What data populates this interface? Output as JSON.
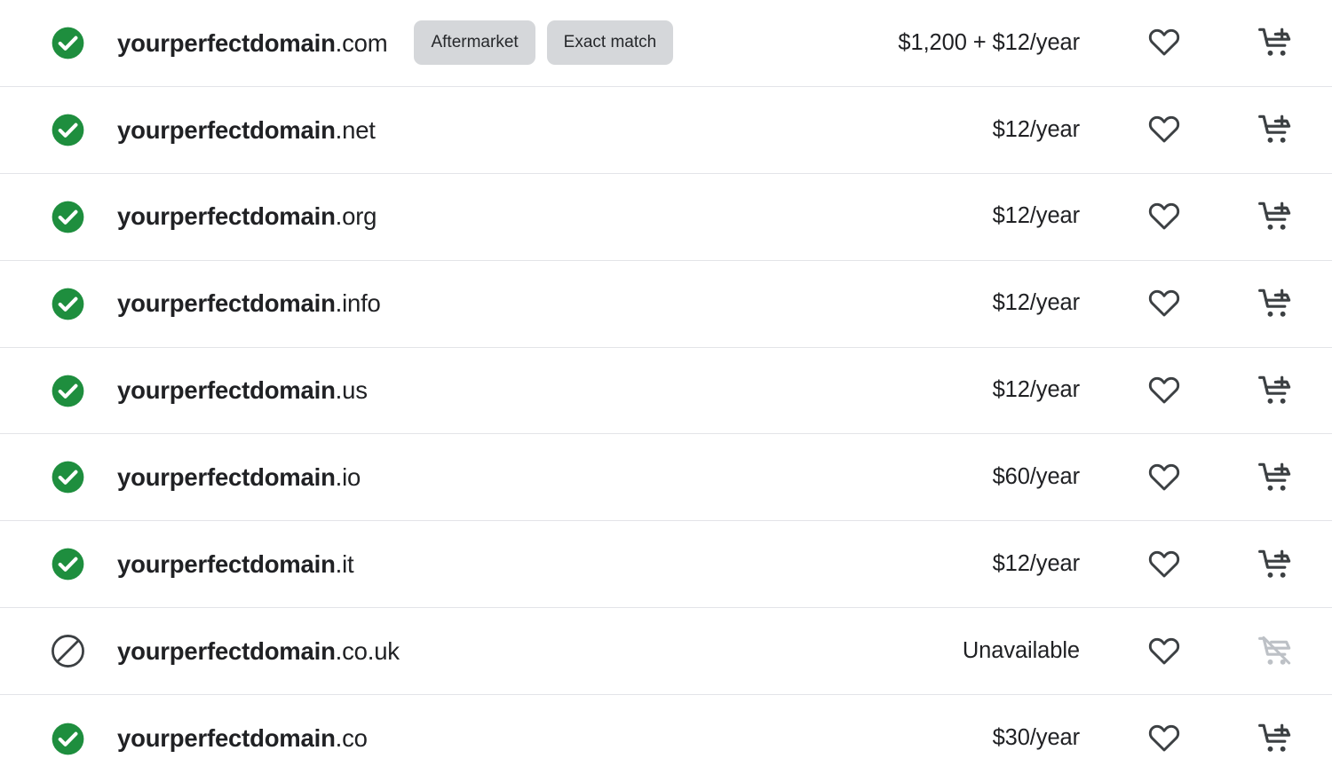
{
  "colors": {
    "available_green": "#1E8E3E",
    "icon_dark": "#3c4043",
    "icon_disabled": "#bdc1c6",
    "badge_bg": "#d5d7da",
    "text_primary": "#202124",
    "row_divider": "#e3e4e8",
    "page_bg": "#ffffff"
  },
  "icons": {
    "available": "check-circle-filled-icon",
    "unavailable": "slashed-circle-icon",
    "favorite": "heart-outline-icon",
    "add_to_cart": "cart-plus-icon",
    "cart_unavailable": "cart-slashed-icon"
  },
  "labels": {
    "unavailable_price": "Unavailable",
    "favorite_action": "Add to favorites",
    "cart_action": "Add to cart"
  },
  "results": [
    {
      "sld": "yourperfectdomain",
      "tld": ".com",
      "available": true,
      "price": "$1,200 + $12/year",
      "badges": [
        "Aftermarket",
        "Exact match"
      ]
    },
    {
      "sld": "yourperfectdomain",
      "tld": ".net",
      "available": true,
      "price": "$12/year",
      "badges": []
    },
    {
      "sld": "yourperfectdomain",
      "tld": ".org",
      "available": true,
      "price": "$12/year",
      "badges": []
    },
    {
      "sld": "yourperfectdomain",
      "tld": ".info",
      "available": true,
      "price": "$12/year",
      "badges": []
    },
    {
      "sld": "yourperfectdomain",
      "tld": ".us",
      "available": true,
      "price": "$12/year",
      "badges": []
    },
    {
      "sld": "yourperfectdomain",
      "tld": ".io",
      "available": true,
      "price": "$60/year",
      "badges": []
    },
    {
      "sld": "yourperfectdomain",
      "tld": ".it",
      "available": true,
      "price": "$12/year",
      "badges": []
    },
    {
      "sld": "yourperfectdomain",
      "tld": ".co.uk",
      "available": false,
      "price": "Unavailable",
      "badges": []
    },
    {
      "sld": "yourperfectdomain",
      "tld": ".co",
      "available": true,
      "price": "$30/year",
      "badges": []
    }
  ]
}
